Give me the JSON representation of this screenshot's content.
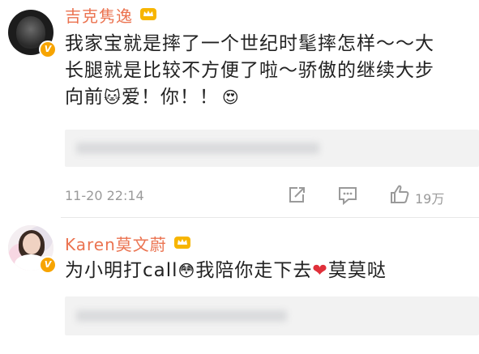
{
  "comments": [
    {
      "username": "吉克隽逸",
      "text_line1": "我家宝就是摔了一个世纪时髦摔怎样～～大",
      "text_line2": "长腿就是比较不方便了啦～骄傲的继续大步",
      "text_line3_before": "向前",
      "text_line3_after": "爱！你！！",
      "emoji_cat": "🐱",
      "emoji_heart_eyes": "😍",
      "timestamp": "11-20 22:14",
      "like_count": "19万"
    },
    {
      "username": "Karen莫文蔚",
      "text_before": "为小明打call",
      "emoji_flushed": "😳",
      "text_middle": "我陪你走下去",
      "emoji_heart": "❤",
      "text_after": "莫莫哒"
    }
  ],
  "colors": {
    "username": "#eb7350",
    "verified_badge": "#f7a400",
    "meta": "#9a9a9a",
    "reply_bg": "#f2f2f2",
    "heart": "#e0303a"
  },
  "icons": [
    "verified-badge-icon",
    "crown-icon",
    "share-icon",
    "comment-icon",
    "like-icon"
  ]
}
